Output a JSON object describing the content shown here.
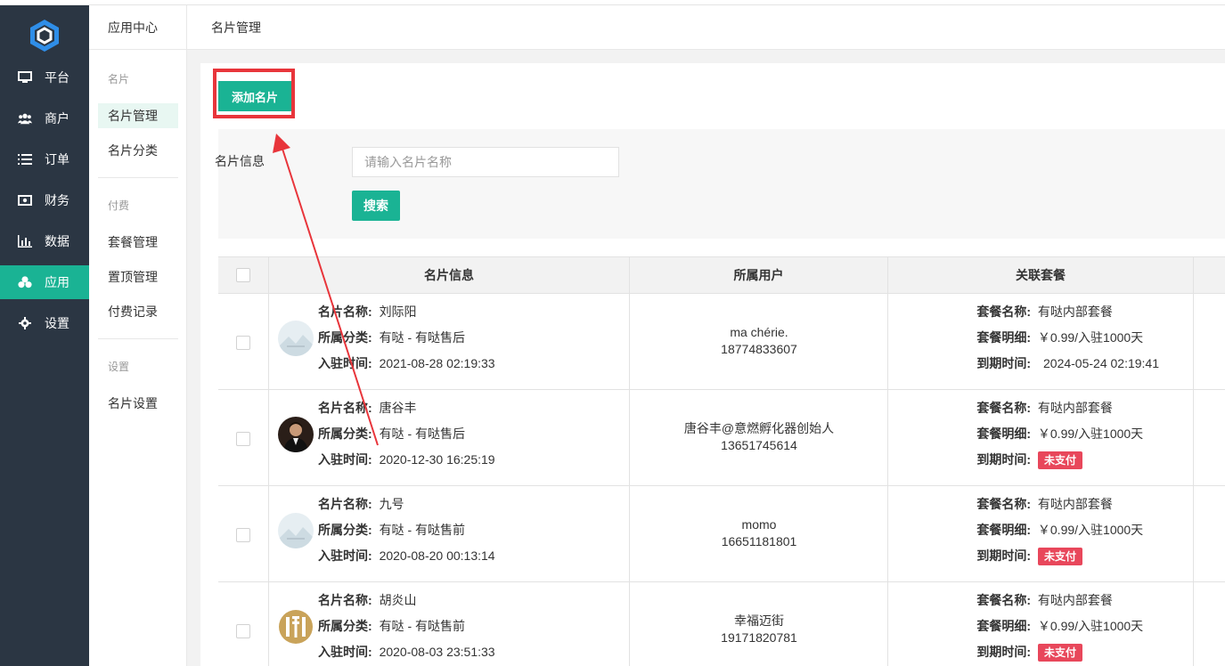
{
  "sidebar": {
    "items": [
      {
        "label": "平台",
        "icon": "monitor-icon"
      },
      {
        "label": "商户",
        "icon": "users-icon"
      },
      {
        "label": "订单",
        "icon": "list-icon"
      },
      {
        "label": "财务",
        "icon": "money-icon"
      },
      {
        "label": "数据",
        "icon": "bar-chart-icon"
      },
      {
        "label": "应用",
        "icon": "cubes-icon"
      },
      {
        "label": "设置",
        "icon": "gear-icon"
      }
    ],
    "active_index": 5
  },
  "subnav": {
    "header": "应用中心",
    "sections": [
      {
        "title": "名片",
        "items": [
          "名片管理",
          "名片分类"
        ]
      },
      {
        "title": "付费",
        "items": [
          "套餐管理",
          "置顶管理",
          "付费记录"
        ]
      },
      {
        "title": "设置",
        "items": [
          "名片设置"
        ]
      }
    ],
    "active": "名片管理"
  },
  "breadcrumb": "名片管理",
  "toolbar": {
    "add_label": "添加名片"
  },
  "filter": {
    "label": "名片信息",
    "placeholder": "请输入名片名称",
    "search_label": "搜索"
  },
  "table": {
    "headers": [
      "名片信息",
      "所属用户",
      "关联套餐"
    ],
    "info_keys": {
      "name": "名片名称:",
      "category": "所属分类:",
      "joined": "入驻时间:"
    },
    "pkg_keys": {
      "name": "套餐名称:",
      "detail": "套餐明细:",
      "expire": "到期时间:"
    },
    "rows": [
      {
        "avatar": "placeholder-avatar",
        "name": "刘际阳",
        "category": "有哒 - 有哒售后",
        "joined": "2021-08-28 02:19:33",
        "user_name": "ma chérie.",
        "user_phone": "18774833607",
        "pkg_name": "有哒内部套餐",
        "pkg_detail": "￥0.99/入驻1000天",
        "expire": "2024-05-24 02:19:41",
        "expire_badge": ""
      },
      {
        "avatar": "person-avatar",
        "name": "唐谷丰",
        "category": "有哒 - 有哒售后",
        "joined": "2020-12-30 16:25:19",
        "user_name": "唐谷丰@意燃孵化器创始人",
        "user_phone": "13651745614",
        "pkg_name": "有哒内部套餐",
        "pkg_detail": "￥0.99/入驻1000天",
        "expire": "",
        "expire_badge": "未支付"
      },
      {
        "avatar": "placeholder-avatar",
        "name": "九号",
        "category": "有哒 - 有哒售前",
        "joined": "2020-08-20 00:13:14",
        "user_name": "momo",
        "user_phone": "16651181801",
        "pkg_name": "有哒内部套餐",
        "pkg_detail": "￥0.99/入驻1000天",
        "expire": "",
        "expire_badge": "未支付"
      },
      {
        "avatar": "street-logo-avatar",
        "name": "胡炎山",
        "category": "有哒 - 有哒售前",
        "joined": "2020-08-03 23:51:33",
        "user_name": "幸福迈街",
        "user_phone": "19171820781",
        "pkg_name": "有哒内部套餐",
        "pkg_detail": "￥0.99/入驻1000天",
        "expire": "",
        "expire_badge": "未支付"
      }
    ]
  },
  "colors": {
    "accent": "#1ab394",
    "sidebar": "#2b3643",
    "annotation": "#e8353b",
    "badge": "#e8475b"
  }
}
